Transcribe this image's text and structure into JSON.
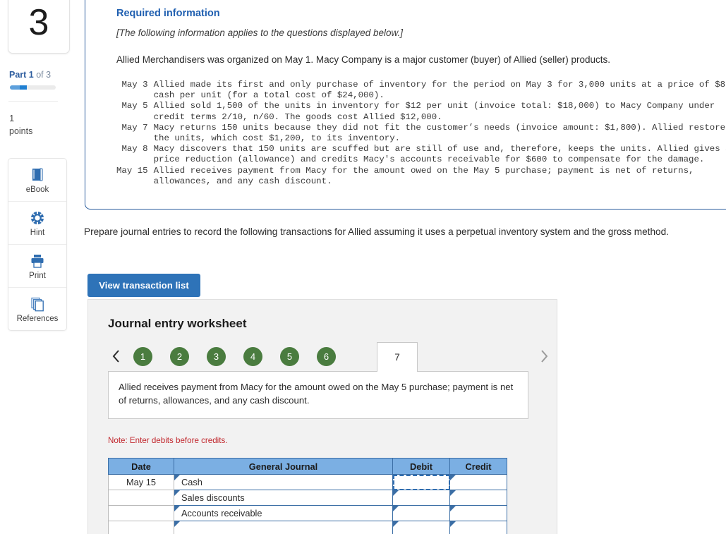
{
  "sidebar": {
    "question_number": "3",
    "part_label_bold": "Part 1",
    "part_label_rest": " of 3",
    "points_value": "1",
    "points_word": "points",
    "tools": [
      {
        "label": "eBook",
        "icon": "book-icon"
      },
      {
        "label": "Hint",
        "icon": "life-ring-icon"
      },
      {
        "label": "Print",
        "icon": "printer-icon"
      },
      {
        "label": "References",
        "icon": "copy-stack-icon"
      }
    ]
  },
  "required_information": {
    "title": "Required information",
    "applies_note": "[The following information applies to the questions displayed below.]",
    "lead": "Allied Merchandisers was organized on May 1. Macy Company is a major customer (buyer) of Allied (seller) products.",
    "transactions": [
      {
        "date": "May 3",
        "lines": [
          "Allied made its first and only purchase of inventory for the period on May 3 for 3,000 units at a price of $8",
          "cash per unit (for a total cost of $24,000)."
        ]
      },
      {
        "date": "May 5",
        "lines": [
          "Allied sold 1,500 of the units in inventory for $12 per unit (invoice total: $18,000) to Macy Company under",
          "credit terms 2/10, n/60. The goods cost Allied $12,000."
        ]
      },
      {
        "date": "May 7",
        "lines": [
          "Macy returns 150 units because they did not fit the customer’s needs (invoice amount: $1,800). Allied restores",
          "the units, which cost $1,200, to its inventory."
        ]
      },
      {
        "date": "May 8",
        "lines": [
          "Macy discovers that 150 units are scuffed but are still of use and, therefore, keeps the units. Allied gives a",
          "price reduction (allowance) and credits Macy's accounts receivable for $600 to compensate for the damage."
        ]
      },
      {
        "date": "May 15",
        "lines": [
          "Allied receives payment from Macy for the amount owed on the May 5 purchase; payment is net of returns,",
          "allowances, and any cash discount."
        ]
      }
    ]
  },
  "prompt": {
    "text": "Prepare journal entries to record the following transactions for Allied assuming it uses a perpetual inventory system and the gross method.",
    "view_transaction_list_label": "View transaction list"
  },
  "worksheet": {
    "title": "Journal entry worksheet",
    "prev_arrow": "‹",
    "next_arrow": "›",
    "tabs": [
      "1",
      "2",
      "3",
      "4",
      "5",
      "6"
    ],
    "active_tab": "7",
    "description": "Allied receives payment from Macy for the amount owed on the May 5 purchase; payment is net of returns, allowances, and any cash discount.",
    "note": "Note: Enter debits before credits.",
    "table": {
      "headers": [
        "Date",
        "General Journal",
        "Debit",
        "Credit"
      ],
      "rows": [
        {
          "date": "May 15",
          "account": "Cash",
          "debit": "",
          "credit": "",
          "debit_selected": true
        },
        {
          "date": "",
          "account": "Sales discounts",
          "debit": "",
          "credit": "",
          "debit_selected": false
        },
        {
          "date": "",
          "account": "Accounts receivable",
          "debit": "",
          "credit": "",
          "debit_selected": false
        },
        {
          "date": "",
          "account": "",
          "debit": "",
          "credit": "",
          "debit_selected": false
        }
      ]
    }
  },
  "colors": {
    "accent_blue": "#2e73b8",
    "panel_border_blue": "#2d5f9e",
    "tab_green": "#4a7c3f",
    "table_header_blue": "#7bafe3",
    "table_grid_blue": "#3b6ea5",
    "note_red": "#c1272d"
  }
}
